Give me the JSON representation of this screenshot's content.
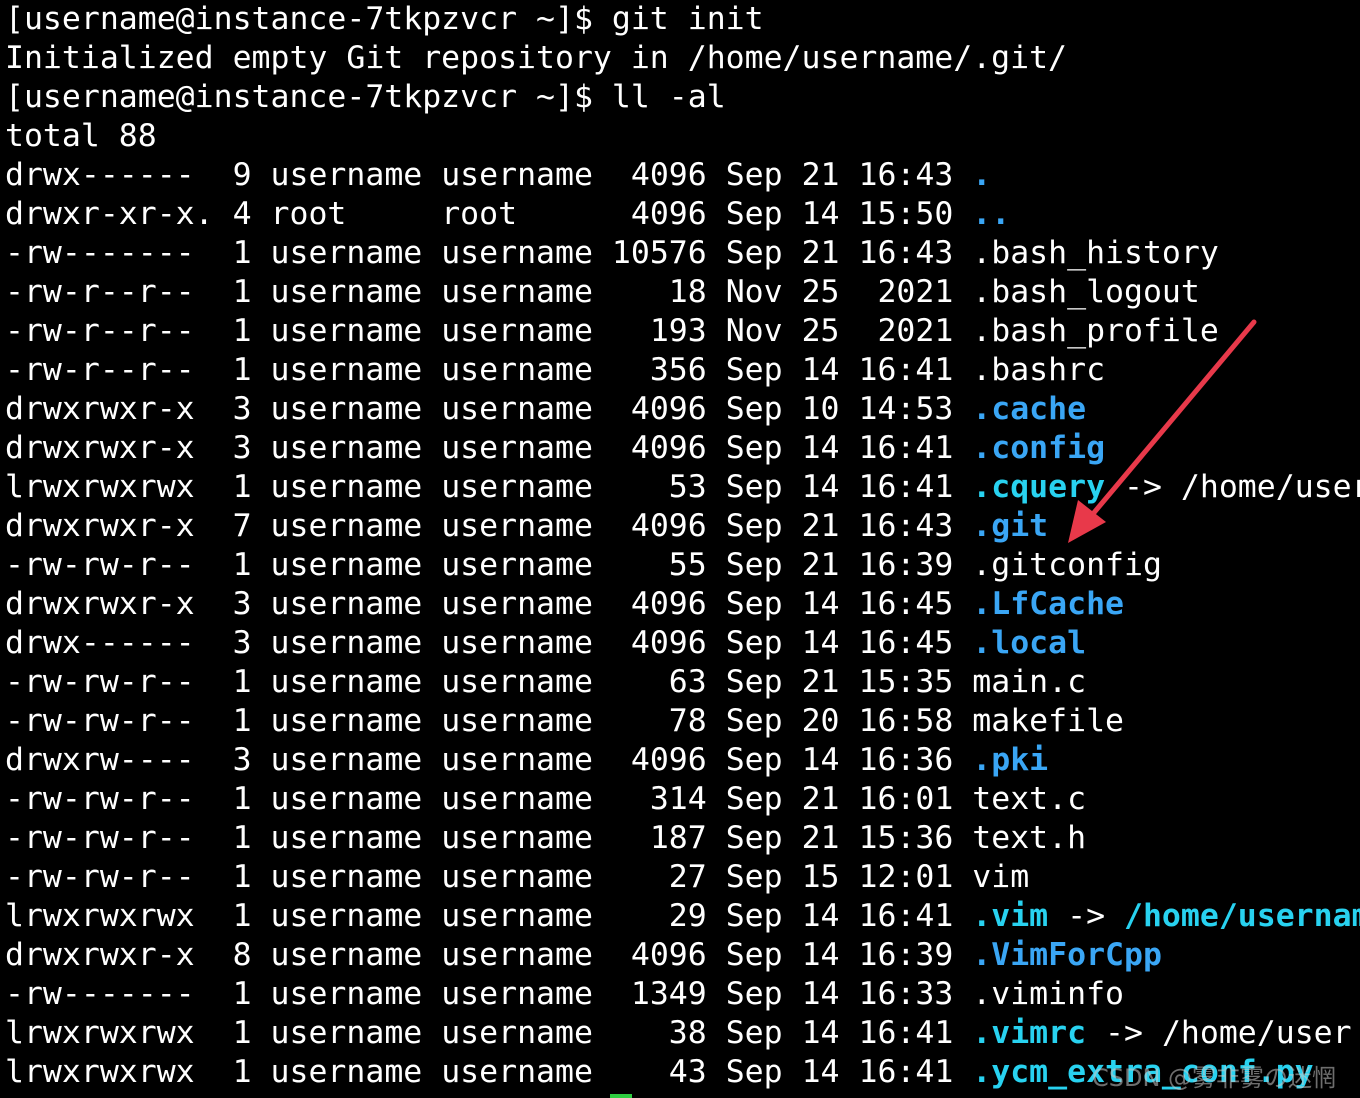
{
  "terminal": {
    "lines": [
      {
        "kind": "prompt",
        "text": "[username@instance-7tkpzvcr ~]$ git init"
      },
      {
        "kind": "output",
        "text": "Initialized empty Git repository in /home/username/.git/"
      },
      {
        "kind": "prompt",
        "text": "[username@instance-7tkpzvcr ~]$ ll -al"
      },
      {
        "kind": "output",
        "text": "total 88"
      }
    ],
    "listing": [
      {
        "perm": "drwx------ ",
        "links": " 9",
        "owner": "username",
        "group": "username",
        "size": " 4096",
        "month": "Sep",
        "day": "21",
        "time": "16:43",
        "name": ".",
        "type": "dir",
        "arrow": "",
        "target": ""
      },
      {
        "perm": "drwxr-xr-x.",
        "links": " 4",
        "owner": "root    ",
        "group": "root    ",
        "size": " 4096",
        "month": "Sep",
        "day": "14",
        "time": "15:50",
        "name": "..",
        "type": "dir",
        "arrow": "",
        "target": ""
      },
      {
        "perm": "-rw------- ",
        "links": " 1",
        "owner": "username",
        "group": "username",
        "size": "10576",
        "month": "Sep",
        "day": "21",
        "time": "16:43",
        "name": ".bash_history",
        "type": "file",
        "arrow": "",
        "target": ""
      },
      {
        "perm": "-rw-r--r-- ",
        "links": " 1",
        "owner": "username",
        "group": "username",
        "size": "   18",
        "month": "Nov",
        "day": "25",
        "time": " 2021",
        "name": ".bash_logout",
        "type": "file",
        "arrow": "",
        "target": ""
      },
      {
        "perm": "-rw-r--r-- ",
        "links": " 1",
        "owner": "username",
        "group": "username",
        "size": "  193",
        "month": "Nov",
        "day": "25",
        "time": " 2021",
        "name": ".bash_profile",
        "type": "file",
        "arrow": "",
        "target": ""
      },
      {
        "perm": "-rw-r--r-- ",
        "links": " 1",
        "owner": "username",
        "group": "username",
        "size": "  356",
        "month": "Sep",
        "day": "14",
        "time": "16:41",
        "name": ".bashrc",
        "type": "file",
        "arrow": "",
        "target": ""
      },
      {
        "perm": "drwxrwxr-x ",
        "links": " 3",
        "owner": "username",
        "group": "username",
        "size": " 4096",
        "month": "Sep",
        "day": "10",
        "time": "14:53",
        "name": ".cache",
        "type": "dir",
        "arrow": "",
        "target": ""
      },
      {
        "perm": "drwxrwxr-x ",
        "links": " 3",
        "owner": "username",
        "group": "username",
        "size": " 4096",
        "month": "Sep",
        "day": "14",
        "time": "16:41",
        "name": ".config",
        "type": "dir",
        "arrow": "",
        "target": ""
      },
      {
        "perm": "lrwxrwxrwx ",
        "links": " 1",
        "owner": "username",
        "group": "username",
        "size": "   53",
        "month": "Sep",
        "day": "14",
        "time": "16:41",
        "name": ".cquery",
        "type": "link",
        "arrow": " -> ",
        "target": "/home/user"
      },
      {
        "perm": "drwxrwxr-x ",
        "links": " 7",
        "owner": "username",
        "group": "username",
        "size": " 4096",
        "month": "Sep",
        "day": "21",
        "time": "16:43",
        "name": ".git",
        "type": "dir",
        "arrow": "",
        "target": ""
      },
      {
        "perm": "-rw-rw-r-- ",
        "links": " 1",
        "owner": "username",
        "group": "username",
        "size": "   55",
        "month": "Sep",
        "day": "21",
        "time": "16:39",
        "name": ".gitconfig",
        "type": "file",
        "arrow": "",
        "target": ""
      },
      {
        "perm": "drwxrwxr-x ",
        "links": " 3",
        "owner": "username",
        "group": "username",
        "size": " 4096",
        "month": "Sep",
        "day": "14",
        "time": "16:45",
        "name": ".LfCache",
        "type": "dir",
        "arrow": "",
        "target": ""
      },
      {
        "perm": "drwx------ ",
        "links": " 3",
        "owner": "username",
        "group": "username",
        "size": " 4096",
        "month": "Sep",
        "day": "14",
        "time": "16:45",
        "name": ".local",
        "type": "dir",
        "arrow": "",
        "target": ""
      },
      {
        "perm": "-rw-rw-r-- ",
        "links": " 1",
        "owner": "username",
        "group": "username",
        "size": "   63",
        "month": "Sep",
        "day": "21",
        "time": "15:35",
        "name": "main.c",
        "type": "file",
        "arrow": "",
        "target": ""
      },
      {
        "perm": "-rw-rw-r-- ",
        "links": " 1",
        "owner": "username",
        "group": "username",
        "size": "   78",
        "month": "Sep",
        "day": "20",
        "time": "16:58",
        "name": "makefile",
        "type": "file",
        "arrow": "",
        "target": ""
      },
      {
        "perm": "drwxrw---- ",
        "links": " 3",
        "owner": "username",
        "group": "username",
        "size": " 4096",
        "month": "Sep",
        "day": "14",
        "time": "16:36",
        "name": ".pki",
        "type": "dir",
        "arrow": "",
        "target": ""
      },
      {
        "perm": "-rw-rw-r-- ",
        "links": " 1",
        "owner": "username",
        "group": "username",
        "size": "  314",
        "month": "Sep",
        "day": "21",
        "time": "16:01",
        "name": "text.c",
        "type": "file",
        "arrow": "",
        "target": ""
      },
      {
        "perm": "-rw-rw-r-- ",
        "links": " 1",
        "owner": "username",
        "group": "username",
        "size": "  187",
        "month": "Sep",
        "day": "21",
        "time": "15:36",
        "name": "text.h",
        "type": "file",
        "arrow": "",
        "target": ""
      },
      {
        "perm": "-rw-rw-r-- ",
        "links": " 1",
        "owner": "username",
        "group": "username",
        "size": "   27",
        "month": "Sep",
        "day": "15",
        "time": "12:01",
        "name": "vim",
        "type": "file",
        "arrow": "",
        "target": ""
      },
      {
        "perm": "lrwxrwxrwx ",
        "links": " 1",
        "owner": "username",
        "group": "username",
        "size": "   29",
        "month": "Sep",
        "day": "14",
        "time": "16:41",
        "name": ".vim",
        "type": "link",
        "arrow": " -> ",
        "target": "/home/usernam",
        "target_highlight": true
      },
      {
        "perm": "drwxrwxr-x ",
        "links": " 8",
        "owner": "username",
        "group": "username",
        "size": " 4096",
        "month": "Sep",
        "day": "14",
        "time": "16:39",
        "name": ".VimForCpp",
        "type": "dir",
        "arrow": "",
        "target": ""
      },
      {
        "perm": "-rw------- ",
        "links": " 1",
        "owner": "username",
        "group": "username",
        "size": " 1349",
        "month": "Sep",
        "day": "14",
        "time": "16:33",
        "name": ".viminfo",
        "type": "file",
        "arrow": "",
        "target": ""
      },
      {
        "perm": "lrwxrwxrwx ",
        "links": " 1",
        "owner": "username",
        "group": "username",
        "size": "   38",
        "month": "Sep",
        "day": "14",
        "time": "16:41",
        "name": ".vimrc",
        "type": "link",
        "arrow": " -> ",
        "target": "/home/user"
      },
      {
        "perm": "lrwxrwxrwx ",
        "links": " 1",
        "owner": "username",
        "group": "username",
        "size": "   43",
        "month": "Sep",
        "day": "14",
        "time": "16:41",
        "name": ".ycm_extra_conf.py",
        "type": "link",
        "arrow": "",
        "target": ""
      }
    ]
  },
  "watermark": {
    "text": "CSDN @雾非雾の迷惘"
  },
  "colors": {
    "background": "#000000",
    "text": "#ffffff",
    "directory": "#3aa6f5",
    "symlink": "#28d2f0",
    "annotation_arrow": "#e8394a"
  }
}
